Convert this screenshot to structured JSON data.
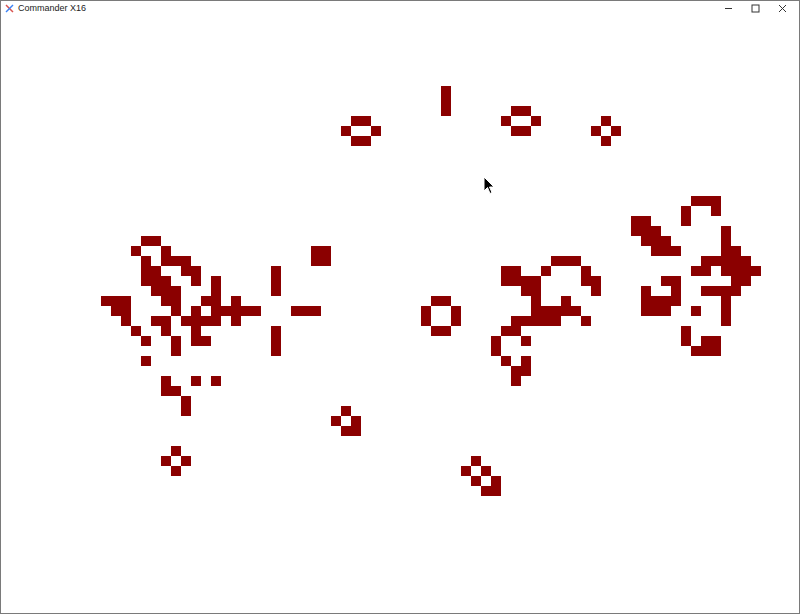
{
  "window": {
    "title": "Commander X16"
  },
  "board": {
    "cols": 80,
    "rows": 60,
    "cell_color": "#8b0000",
    "live": [
      {
        "row": 7,
        "cols": [
          44
        ]
      },
      {
        "row": 8,
        "cols": [
          44
        ]
      },
      {
        "row": 9,
        "cols": [
          44,
          51,
          52
        ]
      },
      {
        "row": 10,
        "cols": [
          35,
          36,
          50,
          53,
          60
        ]
      },
      {
        "row": 11,
        "cols": [
          34,
          37,
          51,
          52,
          59,
          61
        ]
      },
      {
        "row": 12,
        "cols": [
          35,
          36,
          60
        ]
      },
      {
        "row": 18,
        "cols": [
          69,
          70,
          71
        ]
      },
      {
        "row": 19,
        "cols": [
          68,
          71
        ]
      },
      {
        "row": 20,
        "cols": [
          63,
          64,
          68
        ]
      },
      {
        "row": 21,
        "cols": [
          63,
          64,
          65,
          72
        ]
      },
      {
        "row": 22,
        "cols": [
          14,
          15,
          64,
          65,
          66,
          72
        ]
      },
      {
        "row": 23,
        "cols": [
          13,
          16,
          31,
          32,
          65,
          66,
          67,
          72,
          73
        ]
      },
      {
        "row": 24,
        "cols": [
          14,
          16,
          17,
          18,
          31,
          32,
          55,
          56,
          57,
          70,
          71,
          72,
          73,
          74
        ]
      },
      {
        "row": 25,
        "cols": [
          14,
          15,
          18,
          19,
          27,
          50,
          51,
          54,
          58,
          69,
          70,
          72,
          73,
          74,
          75
        ]
      },
      {
        "row": 26,
        "cols": [
          14,
          15,
          16,
          19,
          21,
          27,
          50,
          51,
          52,
          53,
          58,
          59,
          66,
          67,
          73,
          74
        ]
      },
      {
        "row": 27,
        "cols": [
          15,
          16,
          17,
          21,
          27,
          52,
          53,
          59,
          64,
          67,
          70,
          71,
          72,
          73
        ]
      },
      {
        "row": 28,
        "cols": [
          10,
          11,
          12,
          16,
          17,
          20,
          21,
          23,
          43,
          44,
          53,
          56,
          64,
          65,
          66,
          67,
          72
        ]
      },
      {
        "row": 29,
        "cols": [
          11,
          12,
          17,
          19,
          21,
          22,
          23,
          24,
          25,
          29,
          30,
          31,
          42,
          45,
          53,
          54,
          55,
          56,
          57,
          64,
          65,
          66,
          69,
          72
        ]
      },
      {
        "row": 30,
        "cols": [
          12,
          15,
          16,
          18,
          19,
          20,
          21,
          23,
          42,
          45,
          51,
          52,
          53,
          54,
          55,
          58,
          72
        ]
      },
      {
        "row": 31,
        "cols": [
          13,
          16,
          19,
          27,
          43,
          44,
          50,
          51,
          68
        ]
      },
      {
        "row": 32,
        "cols": [
          14,
          17,
          19,
          20,
          27,
          49,
          52,
          68,
          70,
          71
        ]
      },
      {
        "row": 33,
        "cols": [
          17,
          27,
          49,
          69,
          70,
          71
        ]
      },
      {
        "row": 34,
        "cols": [
          14,
          50,
          52
        ]
      },
      {
        "row": 35,
        "cols": [
          51,
          52
        ]
      },
      {
        "row": 36,
        "cols": [
          16,
          19,
          21,
          51
        ]
      },
      {
        "row": 37,
        "cols": [
          16,
          17
        ]
      },
      {
        "row": 38,
        "cols": [
          18
        ]
      },
      {
        "row": 39,
        "cols": [
          18,
          34
        ]
      },
      {
        "row": 40,
        "cols": [
          33,
          35
        ]
      },
      {
        "row": 41,
        "cols": [
          34,
          35
        ]
      },
      {
        "row": 43,
        "cols": [
          17
        ]
      },
      {
        "row": 44,
        "cols": [
          16,
          18,
          47
        ]
      },
      {
        "row": 45,
        "cols": [
          17,
          46,
          48
        ]
      },
      {
        "row": 46,
        "cols": [
          47,
          49
        ]
      },
      {
        "row": 47,
        "cols": [
          48,
          49
        ]
      }
    ]
  }
}
